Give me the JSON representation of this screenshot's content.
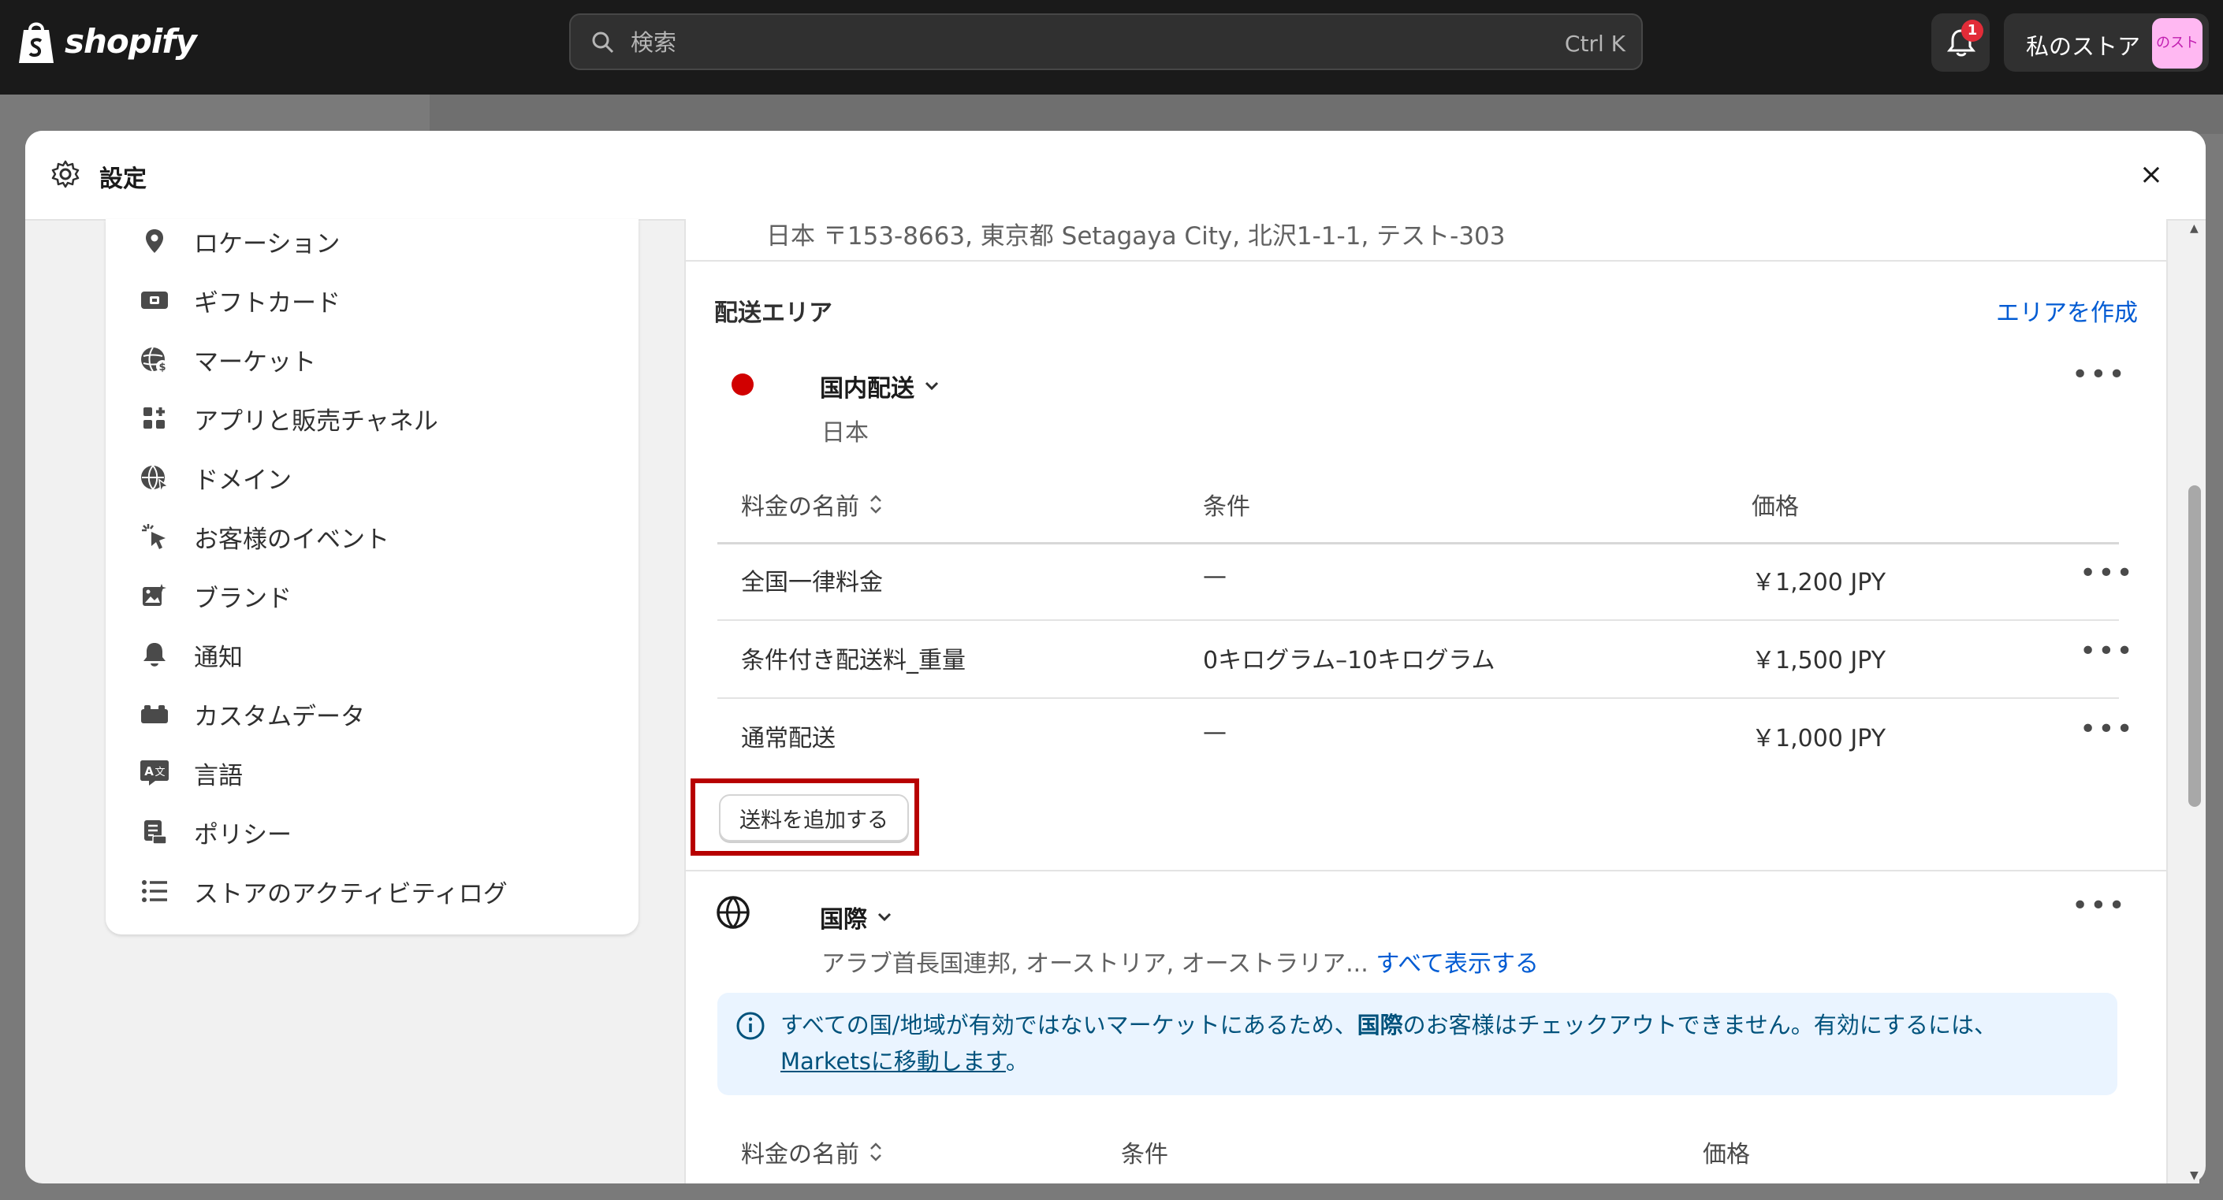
{
  "topbar": {
    "brand": "shopify",
    "search_placeholder": "検索",
    "search_shortcut": "Ctrl K",
    "notification_count": "1",
    "store_name": "私のストア",
    "avatar_text": "のスト"
  },
  "modal": {
    "title": "設定",
    "close_label": "×"
  },
  "sidebar": {
    "items": [
      {
        "label": "ロケーション",
        "icon": "location-pin-icon"
      },
      {
        "label": "ギフトカード",
        "icon": "gift-card-icon"
      },
      {
        "label": "マーケット",
        "icon": "globe-currency-icon"
      },
      {
        "label": "アプリと販売チャネル",
        "icon": "apps-icon"
      },
      {
        "label": "ドメイン",
        "icon": "globe-icon"
      },
      {
        "label": "お客様のイベント",
        "icon": "cursor-click-icon"
      },
      {
        "label": "ブランド",
        "icon": "image-icon"
      },
      {
        "label": "通知",
        "icon": "bell-icon"
      },
      {
        "label": "カスタムデータ",
        "icon": "blocks-icon"
      },
      {
        "label": "言語",
        "icon": "translate-icon"
      },
      {
        "label": "ポリシー",
        "icon": "policy-icon"
      },
      {
        "label": "ストアのアクティビティログ",
        "icon": "list-icon"
      }
    ]
  },
  "shipping": {
    "cut_address": "日本 〒153-8663, 東京都 Setagaya City, 北沢1-1-1, テスト-303",
    "section_title": "配送エリア",
    "create_area": "エリアを作成",
    "domestic": {
      "name": "国内配送",
      "region": "日本",
      "headers": {
        "name": "料金の名前",
        "condition": "条件",
        "price": "価格"
      },
      "rows": [
        {
          "name": "全国一律料金",
          "condition": "—",
          "price": "￥1,200 JPY"
        },
        {
          "name": "条件付き配送料_重量",
          "condition": "0キログラム–10キログラム",
          "price": "￥1,500 JPY"
        },
        {
          "name": "通常配送",
          "condition": "—",
          "price": "￥1,000 JPY"
        }
      ],
      "add_rate": "送料を追加する"
    },
    "international": {
      "name": "国際",
      "regions": "アラブ首長国連邦, オーストリア, オーストラリア...",
      "show_all": "すべて表示する",
      "banner_pre": "すべての国/地域が有効ではないマーケットにあるため、",
      "banner_bold": "国際",
      "banner_mid": "のお客様はチェックアウトできません。有効にするには、",
      "banner_link": "Marketsに移動します",
      "banner_end": "。",
      "headers": {
        "name": "料金の名前",
        "condition": "条件",
        "price": "価格"
      }
    }
  },
  "colors": {
    "topbar_bg": "#1a1a1a",
    "link": "#005bd3",
    "highlight": "#b70000",
    "domestic_dot": "#d10000",
    "banner_bg": "#eaf4ff"
  }
}
